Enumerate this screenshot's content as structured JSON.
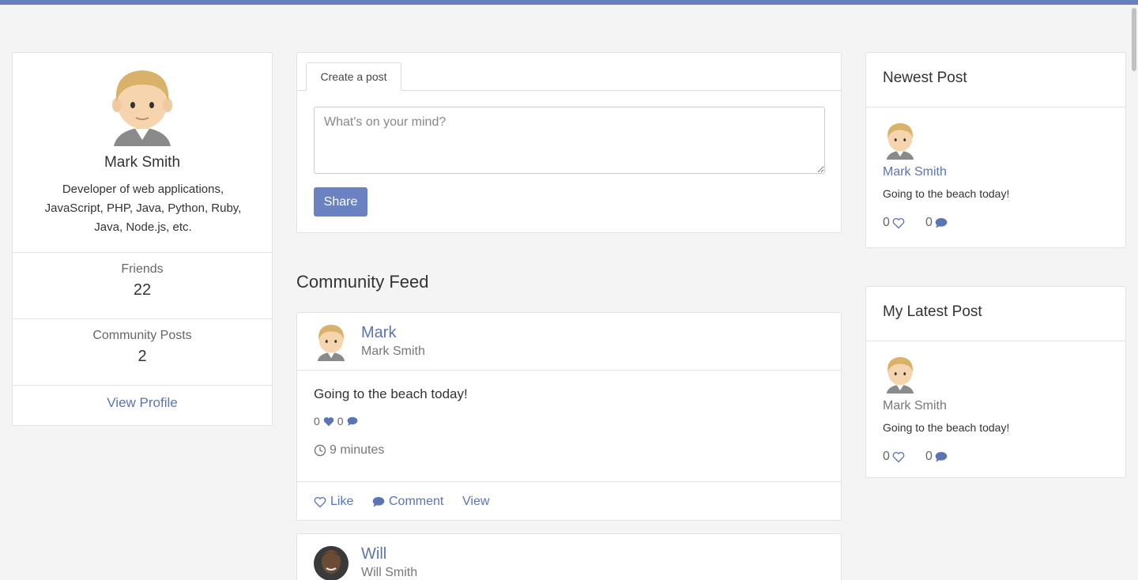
{
  "colors": {
    "accent": "#5b74b3",
    "button": "#6a82c2",
    "topbar": "#6a7fbf",
    "background": "#f4f4f4"
  },
  "profile": {
    "name": "Mark Smith",
    "bio": "Developer of web applications, JavaScript, PHP, Java, Python, Ruby, Java, Node.js, etc.",
    "friends_label": "Friends",
    "friends_count": "22",
    "posts_label": "Community Posts",
    "posts_count": "2",
    "view_profile": "View Profile"
  },
  "create_post": {
    "tab": "Create a post",
    "placeholder": "What's on your mind?",
    "share": "Share"
  },
  "feed": {
    "title": "Community Feed",
    "posts": [
      {
        "username": "Mark",
        "fullname": "Mark Smith",
        "text": "Going to the beach today!",
        "likes": "0",
        "comments": "0",
        "time": "9 minutes",
        "actions": {
          "like": "Like",
          "comment": "Comment",
          "view": "View"
        }
      },
      {
        "username": "Will",
        "fullname": "Will Smith"
      }
    ]
  },
  "newest_post": {
    "title": "Newest Post",
    "name": "Mark Smith",
    "text": "Going to the beach today!",
    "likes": "0",
    "comments": "0"
  },
  "my_latest_post": {
    "title": "My Latest Post",
    "name": "Mark Smith",
    "text": "Going to the beach today!",
    "likes": "0",
    "comments": "0"
  }
}
